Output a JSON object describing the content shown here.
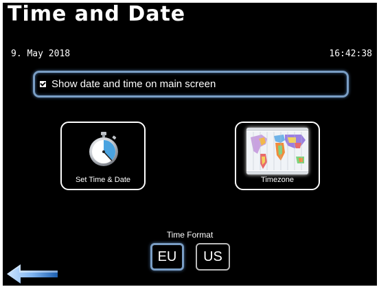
{
  "header": {
    "title": "Time and Date"
  },
  "status": {
    "date": "9. May 2018",
    "time": "16:42:38"
  },
  "option": {
    "show_on_main_label": "Show date and time on main screen",
    "checked": true
  },
  "tiles": {
    "set_time_label": "Set Time & Date",
    "set_time_icon": "stopwatch-icon",
    "timezone_label": "Timezone",
    "timezone_icon": "world-map-icon"
  },
  "time_format": {
    "label": "Time Format",
    "options": [
      "EU",
      "US"
    ],
    "selected": "EU"
  },
  "navigation": {
    "back_icon": "back-arrow-icon"
  },
  "colors": {
    "accent": "#7a9ec5",
    "background": "#000000",
    "text": "#ffffff"
  }
}
